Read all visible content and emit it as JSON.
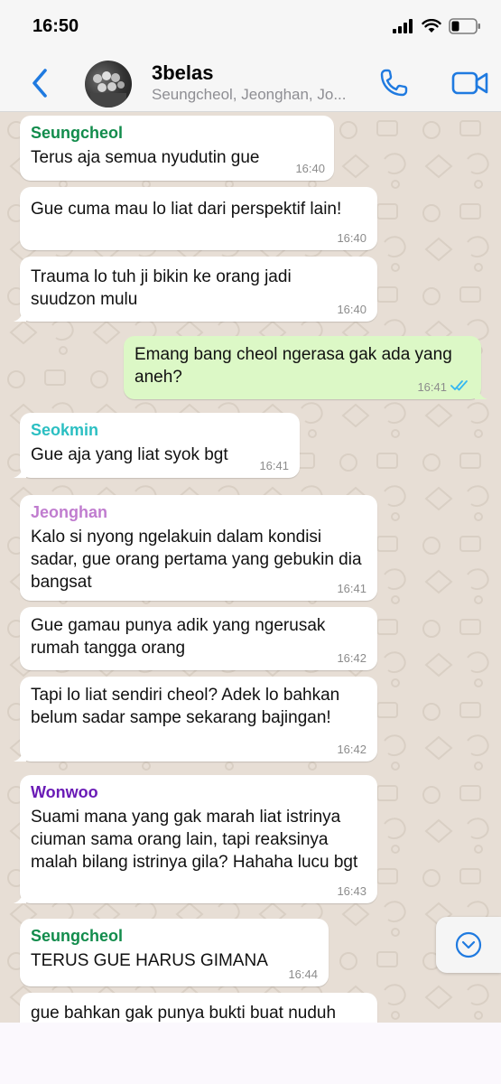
{
  "status_bar": {
    "time": "16:50"
  },
  "header": {
    "title": "3belas",
    "subtitle": "Seungcheol, Jeonghan, Jo..."
  },
  "colors": {
    "accent": "#1f7ae0",
    "outgoing_bubble": "#dcf8c6",
    "incoming_bubble": "#ffffff",
    "wallpaper": "#e7ded5",
    "seungcheol": "#128c4c",
    "seokmin": "#2bbfc2",
    "jeonghan": "#c07ccf",
    "wonwoo": "#6a1bb6",
    "read_ticks": "#34b7f1"
  },
  "messages": [
    {
      "sender": "Seungcheol",
      "text": "Terus aja semua nyudutin gue",
      "time": "16:40"
    },
    {
      "text": "Gue cuma mau lo liat dari perspektif lain!",
      "time": "16:40"
    },
    {
      "text": "Trauma lo tuh ji bikin ke orang jadi suudzon mulu",
      "time": "16:40"
    },
    {
      "outgoing": true,
      "text": "Emang bang cheol ngerasa gak ada yang aneh?",
      "time": "16:41"
    },
    {
      "sender": "Seokmin",
      "text": "Gue aja yang liat syok bgt",
      "time": "16:41"
    },
    {
      "sender": "Jeonghan",
      "text": "Kalo si nyong ngelakuin dalam kondisi sadar, gue orang pertama yang gebukin dia bangsat",
      "time": "16:41"
    },
    {
      "text": "Gue gamau punya adik yang ngerusak rumah tangga orang",
      "time": "16:42"
    },
    {
      "text": "Tapi lo liat sendiri cheol? Adek lo bahkan belum sadar sampe sekarang bajingan!",
      "time": "16:42"
    },
    {
      "sender": "Wonwoo",
      "text": "Suami mana yang gak marah liat istrinya ciuman sama orang lain, tapi reaksinya malah bilang istrinya gila? Hahaha lucu bgt",
      "time": "16:43"
    },
    {
      "sender": "Seungcheol",
      "text": "TERUS GUE HARUS GIMANA",
      "time": "16:44"
    },
    {
      "text": "gue bahkan gak punya bukti buat nuduh"
    }
  ],
  "icons": {
    "back": "chevron-left-icon",
    "call": "phone-icon",
    "video": "video-camera-icon",
    "scroll_down": "chevron-down-circle-icon"
  }
}
